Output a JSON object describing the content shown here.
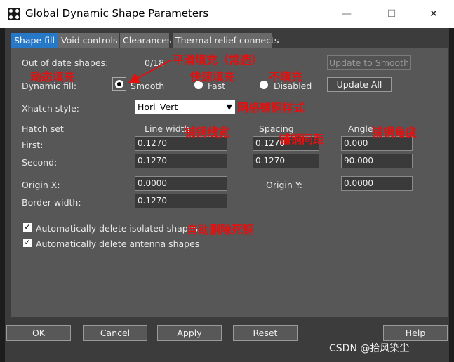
{
  "window": {
    "title": "Global Dynamic Shape Parameters",
    "minimize_glyph": "—",
    "maximize_glyph": "☐",
    "close_glyph": "✕"
  },
  "tabs": [
    {
      "label": "Shape fill",
      "active": true
    },
    {
      "label": "Void controls",
      "active": false
    },
    {
      "label": "Clearances",
      "active": false
    },
    {
      "label": "Thermal relief connects",
      "active": false
    }
  ],
  "shape_fill": {
    "out_of_date_label": "Out of date shapes:",
    "out_of_date_value": "0/18",
    "update_smooth_label": "Update to Smooth",
    "dynamic_fill_label": "Dynamic fill:",
    "fill_options": [
      {
        "label": "Smooth",
        "selected": true
      },
      {
        "label": "Fast",
        "selected": false
      },
      {
        "label": "Disabled",
        "selected": false
      }
    ],
    "update_all_label": "Update All",
    "xhatch_label": "Xhatch style:",
    "xhatch_value": "Hori_Vert",
    "hatch_set_label": "Hatch set",
    "line_width_header": "Line width",
    "spacing_header": "Spacing",
    "angle_header": "Angle",
    "first_label": "First:",
    "first_line_width": "0.1270",
    "first_spacing": "0.1270",
    "first_angle": "0.000",
    "second_label": "Second:",
    "second_line_width": "0.1270",
    "second_spacing": "0.1270",
    "second_angle": "90.000",
    "origin_x_label": "Origin X:",
    "origin_x_value": "0.0000",
    "origin_y_label": "Origin Y:",
    "origin_y_value": "0.0000",
    "border_width_label": "Border width:",
    "border_width_value": "0.1270",
    "auto_delete_isolated_label": "Automatically delete isolated shapes",
    "auto_delete_isolated_checked": true,
    "auto_delete_antenna_label": "Automatically delete antenna shapes",
    "auto_delete_antenna_checked": true
  },
  "annotations": {
    "smooth_note": "平滑填充（常选）",
    "dynamic_fill_note": "动态填充",
    "fast_note": "快速填充",
    "disabled_note": "不填充",
    "xhatch_note": "网格铺铜样式",
    "line_width_note": "铺铜线宽",
    "spacing_note": "铺铜间距",
    "angle_note": "铺铜角度",
    "auto_delete_note": "自动删除死铜",
    "color": "#e31010"
  },
  "footer": {
    "ok_label": "OK",
    "cancel_label": "Cancel",
    "apply_label": "Apply",
    "reset_label": "Reset",
    "help_label": "Help"
  },
  "watermark": "CSDN @拾风染尘"
}
